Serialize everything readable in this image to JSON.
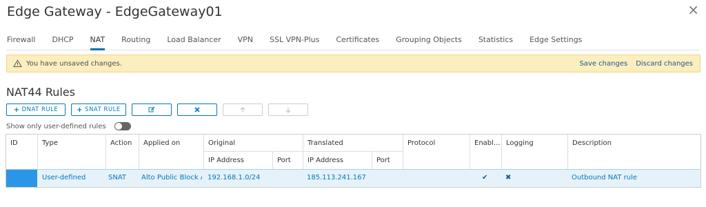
{
  "window": {
    "title": "Edge Gateway - EdgeGateway01",
    "close_glyph": "×"
  },
  "tabs": [
    {
      "label": "Firewall"
    },
    {
      "label": "DHCP"
    },
    {
      "label": "NAT"
    },
    {
      "label": "Routing"
    },
    {
      "label": "Load Balancer"
    },
    {
      "label": "VPN"
    },
    {
      "label": "SSL VPN-Plus"
    },
    {
      "label": "Certificates"
    },
    {
      "label": "Grouping Objects"
    },
    {
      "label": "Statistics"
    },
    {
      "label": "Edge Settings"
    }
  ],
  "active_tab": "NAT",
  "alert": {
    "message": "You have unsaved changes.",
    "save": "Save changes",
    "discard": "Discard changes"
  },
  "section": {
    "title": "NAT44 Rules"
  },
  "toolbar": {
    "dnat": "DNAT RULE",
    "snat": "SNAT RULE",
    "plus": "+"
  },
  "filter": {
    "label": "Show only user-defined rules",
    "enabled": false
  },
  "table": {
    "headers": {
      "id": "ID",
      "type": "Type",
      "action": "Action",
      "applied_on": "Applied on",
      "original": "Original",
      "translated": "Translated",
      "protocol": "Protocol",
      "enabled": "Enabl...",
      "logging": "Logging",
      "description": "Description",
      "ip_address": "IP Address",
      "port": "Port"
    },
    "rows": [
      {
        "type": "User-defined",
        "action": "SNAT",
        "applied_on": "Alto Public Block A",
        "original_ip": "192.168.1.0/24",
        "original_port": "",
        "translated_ip": "185.113.241.167",
        "translated_port": "",
        "protocol": "",
        "enabled": "✔",
        "logging": "✖",
        "description": "Outbound NAT rule"
      }
    ]
  },
  "colors": {
    "accent": "#0079b8",
    "alert_bg": "#fbeebf",
    "selected_row": "#e6f2f9"
  }
}
